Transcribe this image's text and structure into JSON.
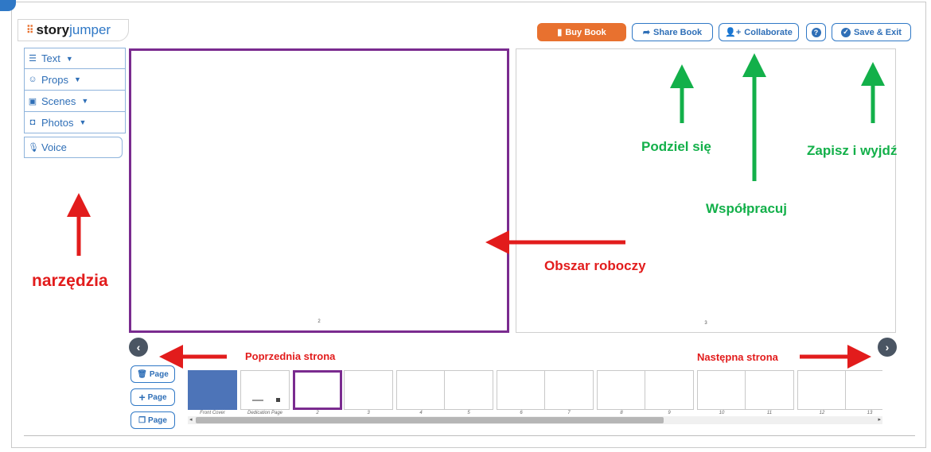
{
  "app": {
    "logo_prefix": "story",
    "logo_suffix": "jumper"
  },
  "toolbar": {
    "buy": "Buy Book",
    "share": "Share Book",
    "collaborate": "Collaborate",
    "help": "?",
    "save": "Save & Exit"
  },
  "tools": [
    {
      "label": "Text",
      "icon": "text-icon"
    },
    {
      "label": "Props",
      "icon": "smiley-icon"
    },
    {
      "label": "Scenes",
      "icon": "image-icon"
    },
    {
      "label": "Photos",
      "icon": "camera-icon"
    },
    {
      "label": "Voice",
      "icon": "microphone-icon"
    }
  ],
  "pages": {
    "left_number": "2",
    "right_number": "3"
  },
  "page_buttons": {
    "delete": "Page",
    "add": "Page",
    "duplicate": "Page"
  },
  "thumbnails": [
    "Front Cover",
    "Dedication Page",
    "2",
    "3",
    "4",
    "5",
    "6",
    "7",
    "8",
    "9",
    "10",
    "11",
    "12",
    "13"
  ],
  "annotations": {
    "tools": "narzędzia",
    "workspace": "Obszar roboczy",
    "share": "Podziel się",
    "collaborate": "Współpracuj",
    "save": "Zapisz i wyjdź",
    "prev": "Poprzednia strona",
    "next": "Następna strona"
  },
  "colors": {
    "accent_blue": "#2f78c6",
    "buy_orange": "#e8712f",
    "selected_purple": "#7a2b8f",
    "annotation_red": "#e21c1c",
    "annotation_green": "#13b04a"
  }
}
